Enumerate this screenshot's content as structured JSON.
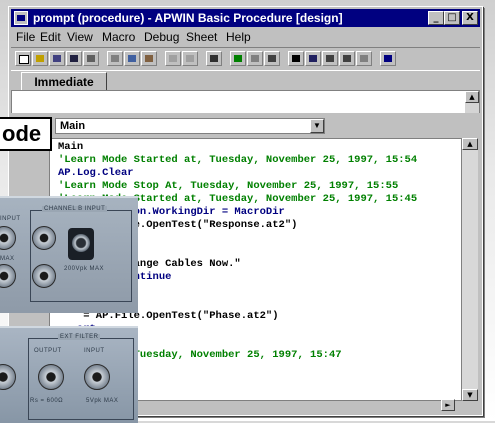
{
  "window": {
    "title": "prompt (procedure) - APWIN Basic Procedure [design]",
    "minimize": "_",
    "maximize": "□",
    "close": "X"
  },
  "menu": [
    "File",
    "Edit",
    "View",
    "Macro",
    "Debug",
    "Sheet",
    "Help"
  ],
  "tabs": {
    "active": "Immediate"
  },
  "editor": {
    "procedure": "Main",
    "lines": [
      {
        "text": "Main",
        "kind": "t"
      },
      {
        "text": "'Learn Mode Started at, Tuesday, November 25, 1997, 15:54",
        "kind": "c"
      },
      {
        "text": "AP.Log.Clear",
        "kind": "k"
      },
      {
        "text": "'Learn Mode Stop At, Tuesday, November 25, 1997, 15:55",
        "kind": "c"
      },
      {
        "text": "'Learn Mode Started at, Tuesday, November 25, 1997, 15:45",
        "kind": "c"
      },
      {
        "text": "AP.Application.WorkingDir = MacroDir",
        "kind": "k"
      },
      {
        "text": "    = AP.File.OpenTest(\"Response.at2\")",
        "kind": "t"
      },
      {
        "text": "   art",
        "kind": "k"
      },
      {
        "text": "",
        "kind": "t"
      },
      {
        "text": "   ext = \"Change Cables Now.\"",
        "kind": "t"
      },
      {
        "text": "   howWithContinue",
        "kind": "k"
      },
      {
        "text": "",
        "kind": "t"
      },
      {
        "text": "",
        "kind": "t"
      },
      {
        "text": "    = AP.File.OpenTest(\"Phase.at2\")",
        "kind": "t"
      },
      {
        "text": "   art",
        "kind": "k"
      },
      {
        "text": "",
        "kind": "t"
      },
      {
        "text": "   Stop At, Tuesday, November 25, 1997, 15:47",
        "kind": "c"
      }
    ]
  },
  "callout": "ode",
  "hardware": {
    "channel_b": "CHANNEL B INPUT",
    "input": "INPUT",
    "max": "MAX",
    "bal_max": "200Vpk MAX",
    "ext_filter": "EXT FILTER",
    "output": "OUTPUT",
    "input2": "INPUT",
    "r_label": "Rs = 600Ω",
    "vpk_max": "5Vpk MAX"
  }
}
